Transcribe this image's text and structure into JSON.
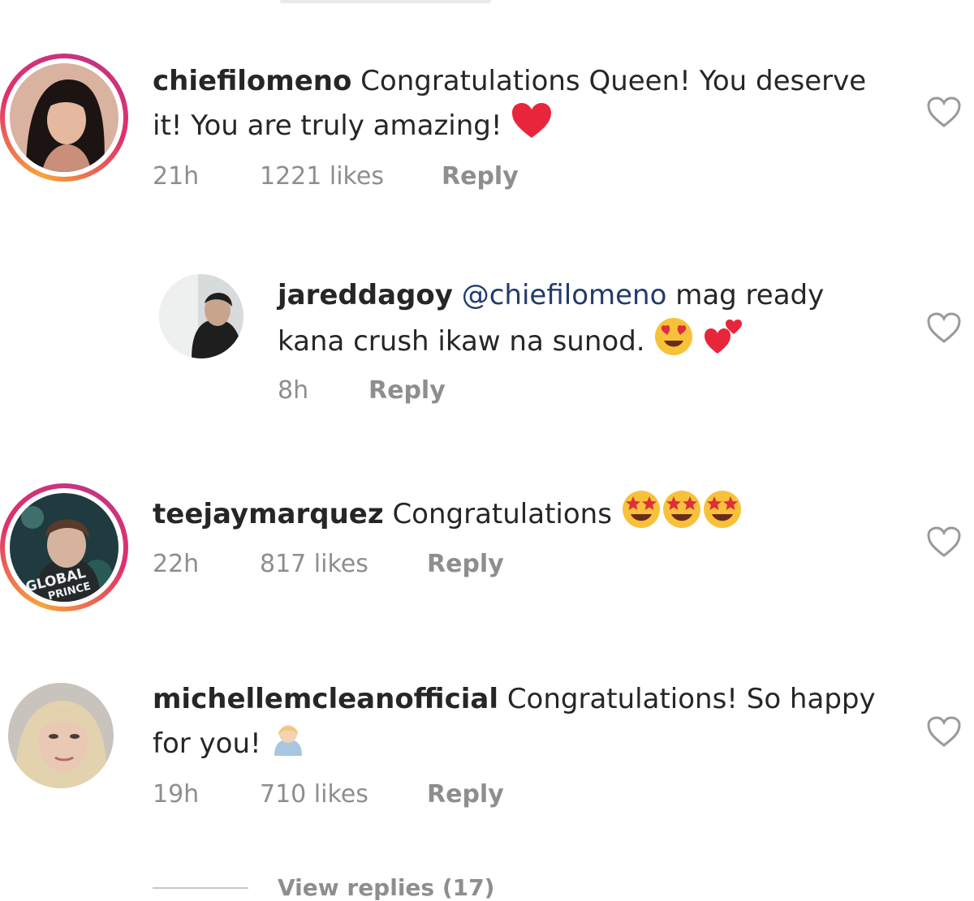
{
  "comments": [
    {
      "username": "chiefilomeno",
      "text_line1": "Congratulations Queen! You deserve",
      "text_line2": "it! You are truly amazing!",
      "time": "21h",
      "likes": "1221 likes",
      "reply": "Reply"
    },
    {
      "username": "jareddagoy",
      "mention": "@chiefilomeno",
      "text_line1": "mag ready",
      "text_line2": "kana crush ikaw na sunod.",
      "time": "8h",
      "reply": "Reply"
    },
    {
      "username": "teejaymarquez",
      "text_line1": "Congratulations",
      "time": "22h",
      "likes": "817 likes",
      "reply": "Reply",
      "avatar_text_1": "GLOBAL",
      "avatar_text_2": "PRINCE"
    },
    {
      "username": "michellemcleanofficial",
      "text_line1": "Congratulations! So happy",
      "text_line2": "for you!",
      "time": "19h",
      "likes": "710 likes",
      "reply": "Reply"
    }
  ],
  "view_replies": "View replies (17)",
  "icons": {
    "heart": "heart-outline-icon",
    "red_heart": "red-heart-emoji",
    "heart_eyes": "heart-eyes-emoji",
    "two_hearts": "two-hearts-emoji",
    "star_struck": "star-struck-emoji",
    "person": "blond-person-emoji"
  },
  "colors": {
    "text": "#262626",
    "meta": "#8e8e8e",
    "mention": "#233a6b",
    "red": "#e8253a",
    "ring_orange": "#f6a53a",
    "ring_pink": "#c13584"
  }
}
